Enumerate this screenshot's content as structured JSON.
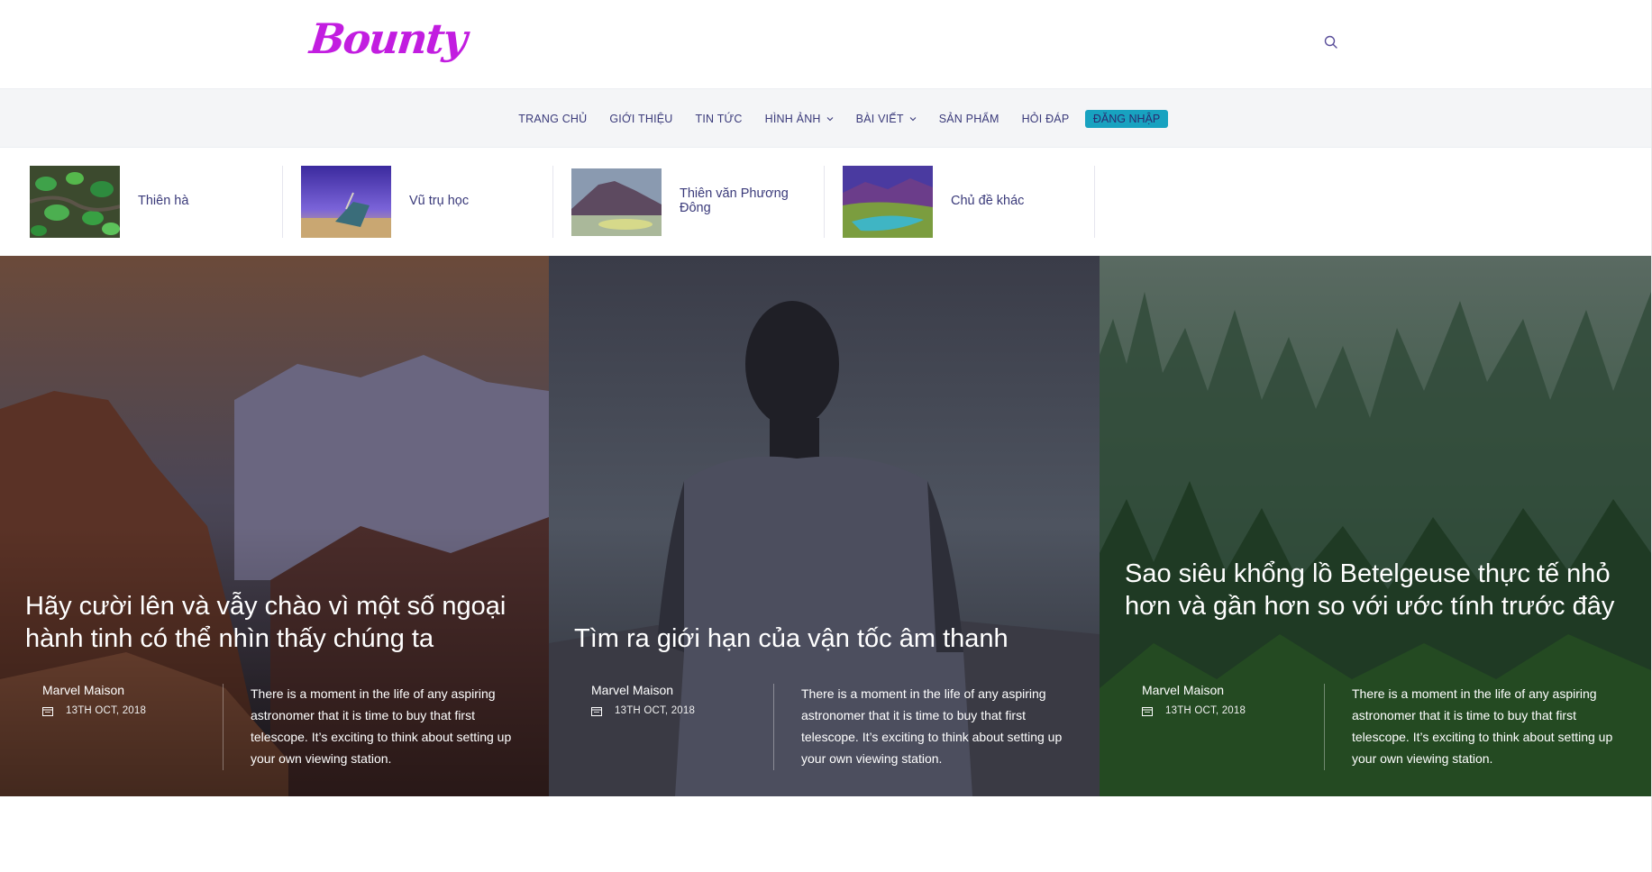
{
  "header": {
    "logo_text": "Bounty",
    "logo_color": "#c21de0",
    "search_icon": "search-icon"
  },
  "nav": {
    "items": [
      {
        "label": "TRANG CHỦ",
        "has_dropdown": false
      },
      {
        "label": "GIỚI THIỆU",
        "has_dropdown": false
      },
      {
        "label": "TIN TỨC",
        "has_dropdown": false
      },
      {
        "label": "HÌNH ẢNH",
        "has_dropdown": true
      },
      {
        "label": "BÀI VIẾT",
        "has_dropdown": true
      },
      {
        "label": "SẢN PHẨM",
        "has_dropdown": false
      },
      {
        "label": "HỎI ĐÁP",
        "has_dropdown": false
      }
    ],
    "login_label": "ĐĂNG NHẬP",
    "login_color": "#18a2c0"
  },
  "categories": [
    {
      "label": "Thiên hà"
    },
    {
      "label": "Vũ trụ học"
    },
    {
      "label": "Thiên văn Phương Đông"
    },
    {
      "label": "Chủ đề khác"
    }
  ],
  "posts": [
    {
      "title": "Hãy cười lên và vẫy chào vì một số ngoại hành tinh có thể nhìn thấy chúng ta",
      "author": "Marvel Maison",
      "date": "13TH OCT, 2018",
      "excerpt": "There is a moment in the life of any aspiring astronomer that it is time to buy that first telescope. It’s exciting to think about setting up your own viewing station."
    },
    {
      "title": "Tìm ra giới hạn của vận tốc âm thanh",
      "author": "Marvel Maison",
      "date": "13TH OCT, 2018",
      "excerpt": "There is a moment in the life of any aspiring astronomer that it is time to buy that first telescope. It’s exciting to think about setting up your own viewing station."
    },
    {
      "title": "Sao siêu khổng lồ Betelgeuse thực tế nhỏ hơn và gần hơn so với ước tính trước đây",
      "author": "Marvel Maison",
      "date": "13TH OCT, 2018",
      "excerpt": "There is a moment in the life of any aspiring astronomer that it is time to buy that first telescope. It’s exciting to think about setting up your own viewing station."
    }
  ]
}
